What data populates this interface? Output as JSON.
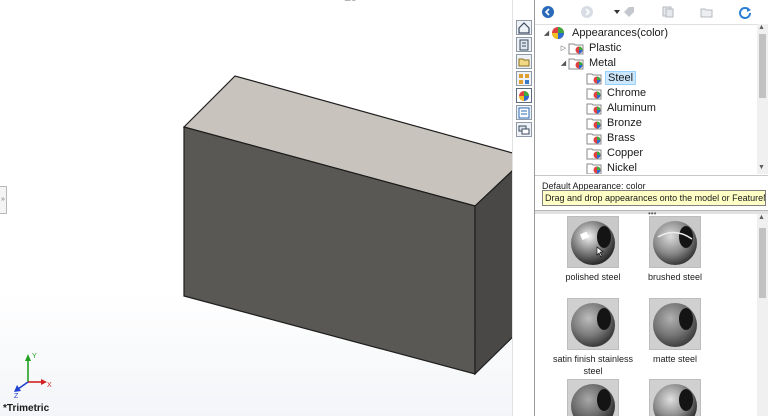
{
  "viewport": {
    "view_name": "*Trimetric",
    "triad_labels": [
      "Y",
      "X",
      "Z"
    ]
  },
  "tabs": [
    {
      "name": "home-icon",
      "active": false
    },
    {
      "name": "design-library-icon",
      "active": false
    },
    {
      "name": "file-explorer-icon",
      "active": false
    },
    {
      "name": "view-palette-icon",
      "active": false
    },
    {
      "name": "appearances-icon",
      "active": true
    },
    {
      "name": "custom-properties-icon",
      "active": false
    },
    {
      "name": "solidworks-forum-icon",
      "active": false
    }
  ],
  "toolbar": {
    "icons": [
      "back-icon",
      "forward-icon",
      "dropdown-arrow-icon",
      "tag-icon",
      "copy-icon",
      "add-folder-icon",
      "refresh-icon"
    ]
  },
  "tree": {
    "root": "Appearances(color)",
    "items": [
      {
        "label": "Plastic",
        "level": 1,
        "expanded": false
      },
      {
        "label": "Metal",
        "level": 1,
        "expanded": true
      },
      {
        "label": "Steel",
        "level": 2,
        "selected": true
      },
      {
        "label": "Chrome",
        "level": 2
      },
      {
        "label": "Aluminum",
        "level": 2
      },
      {
        "label": "Bronze",
        "level": 2
      },
      {
        "label": "Brass",
        "level": 2
      },
      {
        "label": "Copper",
        "level": 2
      },
      {
        "label": "Nickel",
        "level": 2
      }
    ]
  },
  "description": {
    "label": "Default Appearance: color",
    "tooltip": "Drag and drop appearances onto the model or FeatureMa..."
  },
  "gallery": {
    "swatches": [
      {
        "label": "polished steel"
      },
      {
        "label": "brushed steel"
      },
      {
        "label": "satin finish stainless steel"
      },
      {
        "label": "matte steel"
      },
      {
        "label": ""
      },
      {
        "label": ""
      }
    ]
  },
  "colors": {
    "box_top": "#c8c4bd",
    "box_front": "#5a5855",
    "box_side": "#4a4846",
    "tooltip_bg": "#ffffc6",
    "selection": "#cce8ff",
    "accent_blue": "#1e6fc4"
  }
}
